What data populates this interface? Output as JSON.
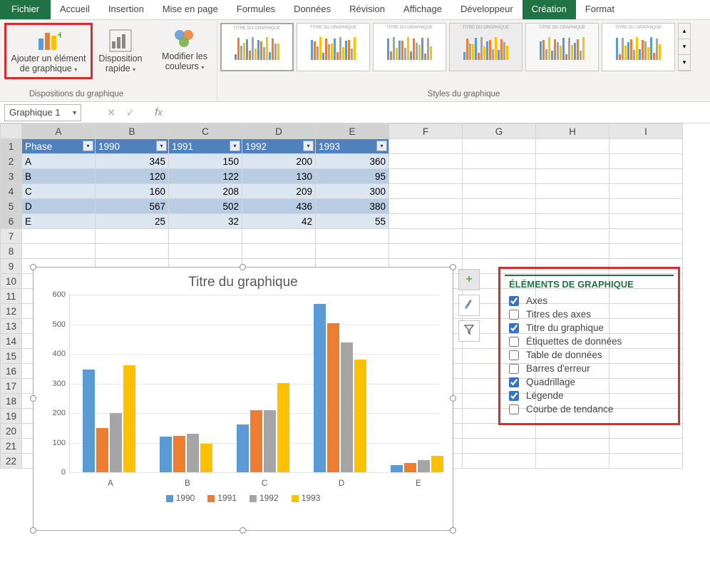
{
  "menu": {
    "file": "Fichier",
    "tabs": [
      "Accueil",
      "Insertion",
      "Mise en page",
      "Formules",
      "Données",
      "Révision",
      "Affichage",
      "Développeur",
      "Création",
      "Format"
    ],
    "active_index": 8
  },
  "ribbon": {
    "add_element": "Ajouter un élément de graphique",
    "quick_layout": "Disposition rapide",
    "change_colors": "Modifier les couleurs",
    "group_layouts": "Dispositions du graphique",
    "group_styles": "Styles du graphique"
  },
  "name_box": "Graphique 1",
  "columns": [
    "A",
    "B",
    "C",
    "D",
    "E",
    "F",
    "G",
    "H",
    "I"
  ],
  "table": {
    "headers": [
      "Phase",
      "1990",
      "1991",
      "1992",
      "1993"
    ],
    "rows": [
      [
        "A",
        345,
        150,
        200,
        360
      ],
      [
        "B",
        120,
        122,
        130,
        95
      ],
      [
        "C",
        160,
        208,
        209,
        300
      ],
      [
        "D",
        567,
        502,
        436,
        380
      ],
      [
        "E",
        25,
        32,
        42,
        55
      ]
    ]
  },
  "chart_data": {
    "type": "bar",
    "title": "Titre du graphique",
    "categories": [
      "A",
      "B",
      "C",
      "D",
      "E"
    ],
    "series": [
      {
        "name": "1990",
        "values": [
          345,
          120,
          160,
          567,
          25
        ],
        "color": "#5b9bd5"
      },
      {
        "name": "1991",
        "values": [
          150,
          122,
          208,
          502,
          32
        ],
        "color": "#ed7d31"
      },
      {
        "name": "1992",
        "values": [
          200,
          130,
          209,
          436,
          42
        ],
        "color": "#a5a5a5"
      },
      {
        "name": "1993",
        "values": [
          360,
          95,
          300,
          380,
          55
        ],
        "color": "#ffc000"
      }
    ],
    "ylim": [
      0,
      600
    ],
    "ystep": 100,
    "xlabel": "",
    "ylabel": ""
  },
  "elements_panel": {
    "title": "ÉLÉMENTS DE GRAPHIQUE",
    "items": [
      {
        "label": "Axes",
        "checked": true
      },
      {
        "label": "Titres des axes",
        "checked": false
      },
      {
        "label": "Titre du graphique",
        "checked": true
      },
      {
        "label": "Étiquettes de données",
        "checked": false
      },
      {
        "label": "Table de données",
        "checked": false
      },
      {
        "label": "Barres d'erreur",
        "checked": false
      },
      {
        "label": "Quadrillage",
        "checked": true
      },
      {
        "label": "Légende",
        "checked": true
      },
      {
        "label": "Courbe de tendance",
        "checked": false
      }
    ]
  }
}
